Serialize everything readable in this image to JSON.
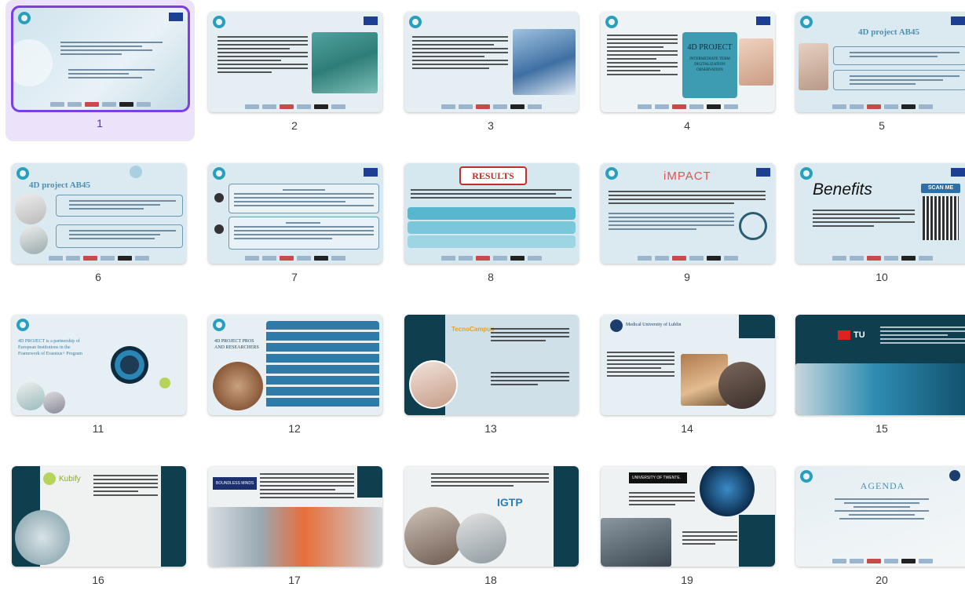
{
  "slides": [
    {
      "number": "1",
      "selected": true
    },
    {
      "number": "2"
    },
    {
      "number": "3"
    },
    {
      "number": "4",
      "heading": "4D PROJECT",
      "subheading": "INTERMEDIATE TERM DIGITALIZATION OBSERVATION"
    },
    {
      "number": "5",
      "heading": "4D project AB45"
    },
    {
      "number": "6",
      "heading": "4D project AB45"
    },
    {
      "number": "7"
    },
    {
      "number": "8",
      "heading": "RESULTS"
    },
    {
      "number": "9",
      "heading": "iMPACT"
    },
    {
      "number": "10",
      "heading": "Benefits",
      "badge": "SCAN ME"
    },
    {
      "number": "11",
      "heading": "4D PROJECT is a partnership of European Institutions in the Framework of Erasmus+ Program"
    },
    {
      "number": "12",
      "heading": "4D PROJECT PROS AND RESEARCHERS"
    },
    {
      "number": "13",
      "brand": "TecnoCampus"
    },
    {
      "number": "14",
      "brand": "Medical University of Lublin"
    },
    {
      "number": "15",
      "brand": "TU"
    },
    {
      "number": "16",
      "brand": "Kubify"
    },
    {
      "number": "17",
      "brand": "BOUNDLESS MINDS"
    },
    {
      "number": "18",
      "brand": "IGTP"
    },
    {
      "number": "19",
      "brand": "UNIVERSITY OF TWENTE."
    },
    {
      "number": "20",
      "heading": "AGENDA"
    }
  ],
  "colors": {
    "selection": "#7b3fe4",
    "selection_bg": "#ece3fb",
    "teal": "#0f3e4e",
    "accent_blue": "#2a9fbd",
    "results_red": "#c0302a"
  },
  "icons": {
    "app_logo": "circular-swirl-logo-icon",
    "eu_flag": "eu-flag-icon",
    "qr": "qr-code-icon",
    "globe": "globe-network-icon"
  }
}
